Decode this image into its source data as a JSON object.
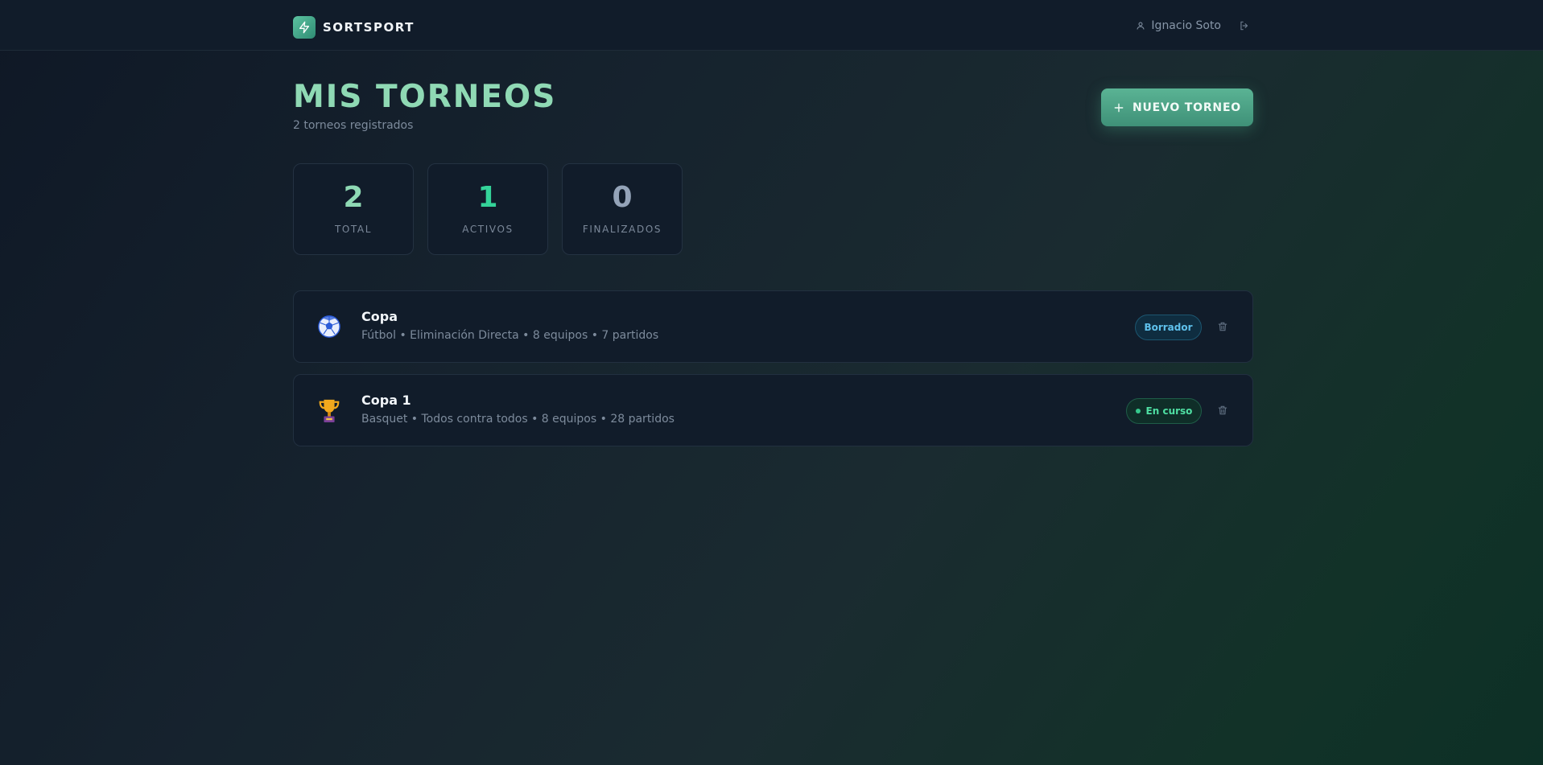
{
  "header": {
    "brand_name": "SORTSPORT",
    "user_name": "Ignacio Soto"
  },
  "main": {
    "title": "MIS TORNEOS",
    "subtitle": "2 torneos registrados",
    "new_button_label": "NUEVO TORNEO"
  },
  "stats": [
    {
      "value": "2",
      "label": "TOTAL",
      "color": "#8fd9b4"
    },
    {
      "value": "1",
      "label": "ACTIVOS",
      "color": "#34d399"
    },
    {
      "value": "0",
      "label": "FINALIZADOS",
      "color": "#94a3b8"
    }
  ],
  "tournaments": [
    {
      "icon": "soccer-ball-icon",
      "emoji": "⚽",
      "name": "Copa",
      "meta": "Fútbol • Eliminación Directa • 8 equipos • 7 partidos",
      "status": "Borrador"
    },
    {
      "icon": "trophy-icon",
      "emoji": "🏆",
      "name": "Copa 1",
      "meta": "Basquet • Todos contra todos • 8 equipos • 28 partidos",
      "status": "En curso"
    }
  ],
  "colors": {
    "accent": "#4fa98a",
    "draft": "#5fc1ec",
    "live": "#4fe0a3"
  }
}
